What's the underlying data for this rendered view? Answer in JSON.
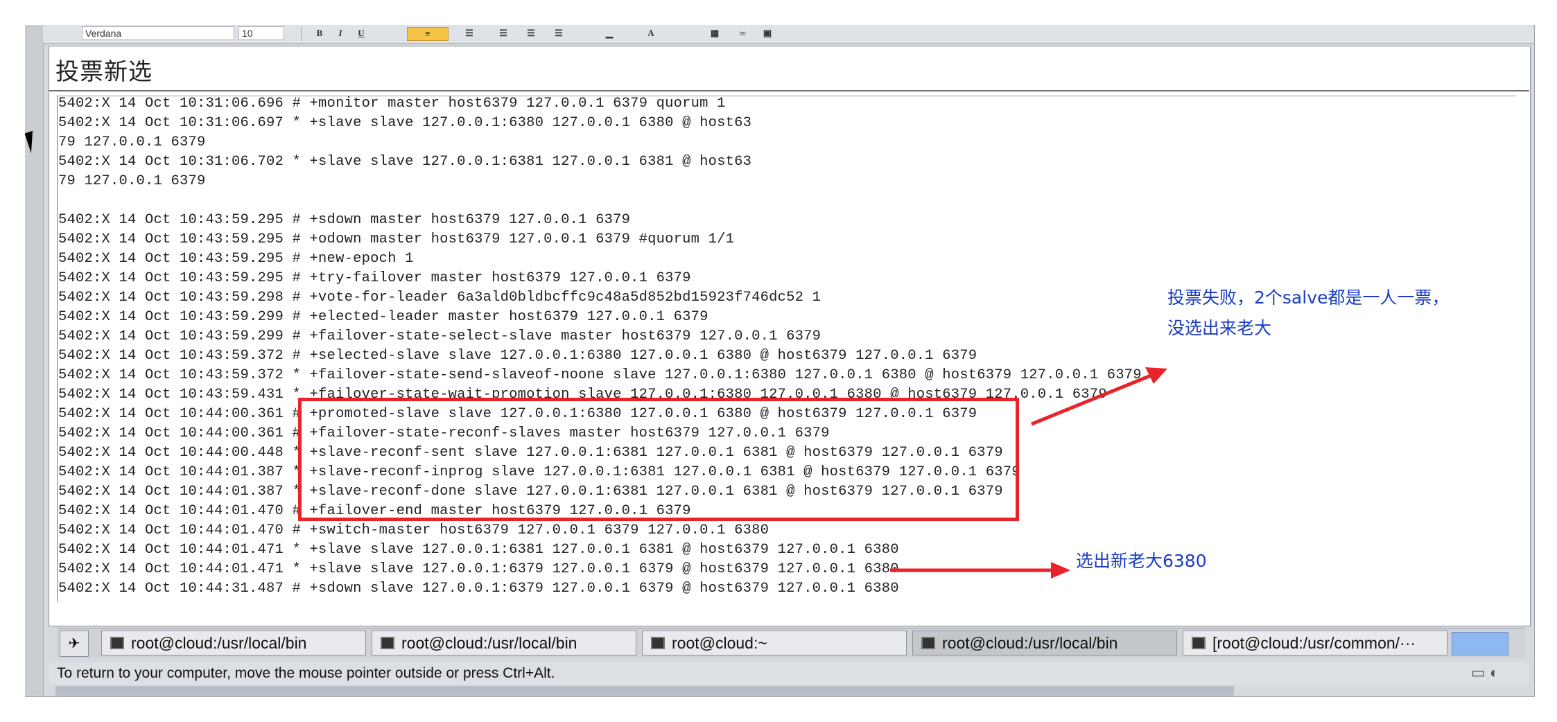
{
  "toolbar": {
    "font_name": "Verdana",
    "font_size": "10",
    "bold": "B",
    "italic": "I",
    "underline": "U"
  },
  "document": {
    "title": "投票新选"
  },
  "log_lines": [
    "5402:X 14 Oct 10:31:06.696 # +monitor master host6379 127.0.0.1 6379 quorum 1",
    "5402:X 14 Oct 10:31:06.697 * +slave slave 127.0.0.1:6380 127.0.0.1 6380 @ host63",
    "79 127.0.0.1 6379",
    "5402:X 14 Oct 10:31:06.702 * +slave slave 127.0.0.1:6381 127.0.0.1 6381 @ host63",
    "79 127.0.0.1 6379",
    "",
    "5402:X 14 Oct 10:43:59.295 # +sdown master host6379 127.0.0.1 6379",
    "5402:X 14 Oct 10:43:59.295 # +odown master host6379 127.0.0.1 6379 #quorum 1/1",
    "5402:X 14 Oct 10:43:59.295 # +new-epoch 1",
    "5402:X 14 Oct 10:43:59.295 # +try-failover master host6379 127.0.0.1 6379",
    "5402:X 14 Oct 10:43:59.298 # +vote-for-leader 6a3ald0bldbcffc9c48a5d852bd15923f746dc52 1",
    "5402:X 14 Oct 10:43:59.299 # +elected-leader master host6379 127.0.0.1 6379",
    "5402:X 14 Oct 10:43:59.299 # +failover-state-select-slave master host6379 127.0.0.1 6379",
    "5402:X 14 Oct 10:43:59.372 # +selected-slave slave 127.0.0.1:6380 127.0.0.1 6380 @ host6379 127.0.0.1 6379",
    "5402:X 14 Oct 10:43:59.372 * +failover-state-send-slaveof-noone slave 127.0.0.1:6380 127.0.0.1 6380 @ host6379 127.0.0.1 6379",
    "5402:X 14 Oct 10:43:59.431 * +failover-state-wait-promotion slave 127.0.0.1:6380 127.0.0.1 6380 @ host6379 127.0.0.1 6379",
    "5402:X 14 Oct 10:44:00.361 # +promoted-slave slave 127.0.0.1:6380 127.0.0.1 6380 @ host6379 127.0.0.1 6379",
    "5402:X 14 Oct 10:44:00.361 # +failover-state-reconf-slaves master host6379 127.0.0.1 6379",
    "5402:X 14 Oct 10:44:00.448 * +slave-reconf-sent slave 127.0.0.1:6381 127.0.0.1 6381 @ host6379 127.0.0.1 6379",
    "5402:X 14 Oct 10:44:01.387 * +slave-reconf-inprog slave 127.0.0.1:6381 127.0.0.1 6381 @ host6379 127.0.0.1 6379",
    "5402:X 14 Oct 10:44:01.387 * +slave-reconf-done slave 127.0.0.1:6381 127.0.0.1 6381 @ host6379 127.0.0.1 6379",
    "5402:X 14 Oct 10:44:01.470 # +failover-end master host6379 127.0.0.1 6379",
    "5402:X 14 Oct 10:44:01.470 # +switch-master host6379 127.0.0.1 6379 127.0.0.1 6380",
    "5402:X 14 Oct 10:44:01.471 * +slave slave 127.0.0.1:6381 127.0.0.1 6381 @ host6379 127.0.0.1 6380",
    "5402:X 14 Oct 10:44:01.471 * +slave slave 127.0.0.1:6379 127.0.0.1 6379 @ host6379 127.0.0.1 6380",
    "5402:X 14 Oct 10:44:31.487 # +sdown slave 127.0.0.1:6379 127.0.0.1 6379 @ host6379 127.0.0.1 6380"
  ],
  "annotations": {
    "vote_fail_line1": "投票失败，2个salve都是一人一票，",
    "vote_fail_line2": "没选出来老大",
    "new_master": "选出新老大6380",
    "color": "#1a3cc8",
    "arrow_color": "#e8242a"
  },
  "taskbar": {
    "tasks": [
      "root@cloud:/usr/local/bin",
      "root@cloud:/usr/local/bin",
      "root@cloud:~",
      "root@cloud:/usr/local/bin",
      "[root@cloud:/usr/common/···"
    ]
  },
  "status": {
    "message": "To return to your computer, move the mouse pointer outside or press Ctrl+Alt."
  }
}
